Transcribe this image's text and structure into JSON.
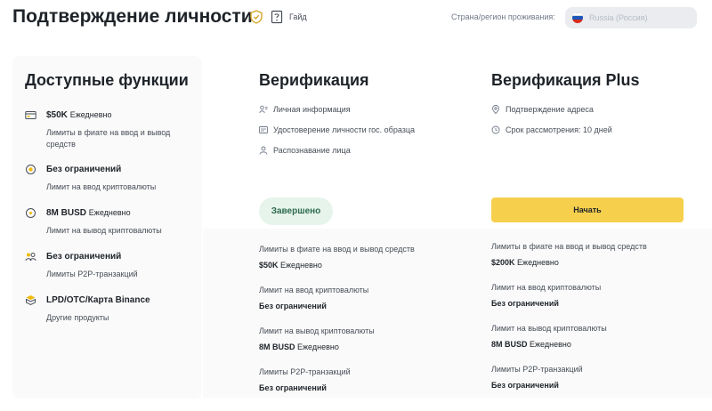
{
  "header": {
    "title": "Подтверждение личности",
    "guide_label": "Гайд",
    "region_label": "Страна/регион проживания:",
    "region_value": "Russia (Россия)"
  },
  "left_panel": {
    "title": "Доступные функции",
    "features": [
      {
        "icon": "card-icon",
        "title": "$50K",
        "daily": "Ежедневно",
        "desc": "Лимиты в фиате на ввод и вывод средств"
      },
      {
        "icon": "crypto-deposit-icon",
        "title": "Без ограничений",
        "daily": "",
        "desc": "Лимит на ввод криптовалюты"
      },
      {
        "icon": "crypto-withdraw-icon",
        "title": "8M BUSD",
        "daily": "Ежедневно",
        "desc": "Лимит на вывод криптовалюты"
      },
      {
        "icon": "p2p-icon",
        "title": "Без ограничений",
        "daily": "",
        "desc": "Лимиты P2P-транзакций"
      },
      {
        "icon": "binance-icon",
        "title": "LPD/OTC/Карта Binance",
        "daily": "",
        "desc": "Другие продукты"
      }
    ]
  },
  "verification": {
    "title": "Верификация",
    "requirements": [
      {
        "icon": "personal-info-icon",
        "label": "Личная информация"
      },
      {
        "icon": "id-card-icon",
        "label": "Удостоверение личности гос. образца"
      },
      {
        "icon": "face-icon",
        "label": "Распознавание лица"
      }
    ],
    "status": "Завершено",
    "limits": [
      {
        "label": "Лимиты в фиате на ввод и вывод средств",
        "value": "$50K",
        "daily": "Ежедневно"
      },
      {
        "label": "Лимит на ввод криптовалюты",
        "value": "Без ограничений",
        "daily": ""
      },
      {
        "label": "Лимит на вывод криптовалюты",
        "value": "8M BUSD",
        "daily": "Ежедневно"
      },
      {
        "label": "Лимиты P2P-транзакций",
        "value": "Без ограничений",
        "daily": ""
      }
    ]
  },
  "verification_plus": {
    "title": "Верификация Plus",
    "requirements": [
      {
        "icon": "location-icon",
        "label": "Подтверждение адреса"
      },
      {
        "icon": "clock-icon",
        "label": "Срок рассмотрения: 10 дней"
      }
    ],
    "start_label": "Начать",
    "limits": [
      {
        "label": "Лимиты в фиате на ввод и вывод средств",
        "value": "$200K",
        "daily": "Ежедневно"
      },
      {
        "label": "Лимит на ввод криптовалюты",
        "value": "Без ограничений",
        "daily": ""
      },
      {
        "label": "Лимит на вывод криптовалюты",
        "value": "8M BUSD",
        "daily": "Ежедневно"
      },
      {
        "label": "Лимиты P2P-транзакций",
        "value": "Без ограничений",
        "daily": ""
      }
    ]
  },
  "colors": {
    "accent_yellow": "#f6d04d",
    "done_bg": "#e6f4ec",
    "done_text": "#2f6b4f",
    "text_primary": "#1e2329"
  }
}
